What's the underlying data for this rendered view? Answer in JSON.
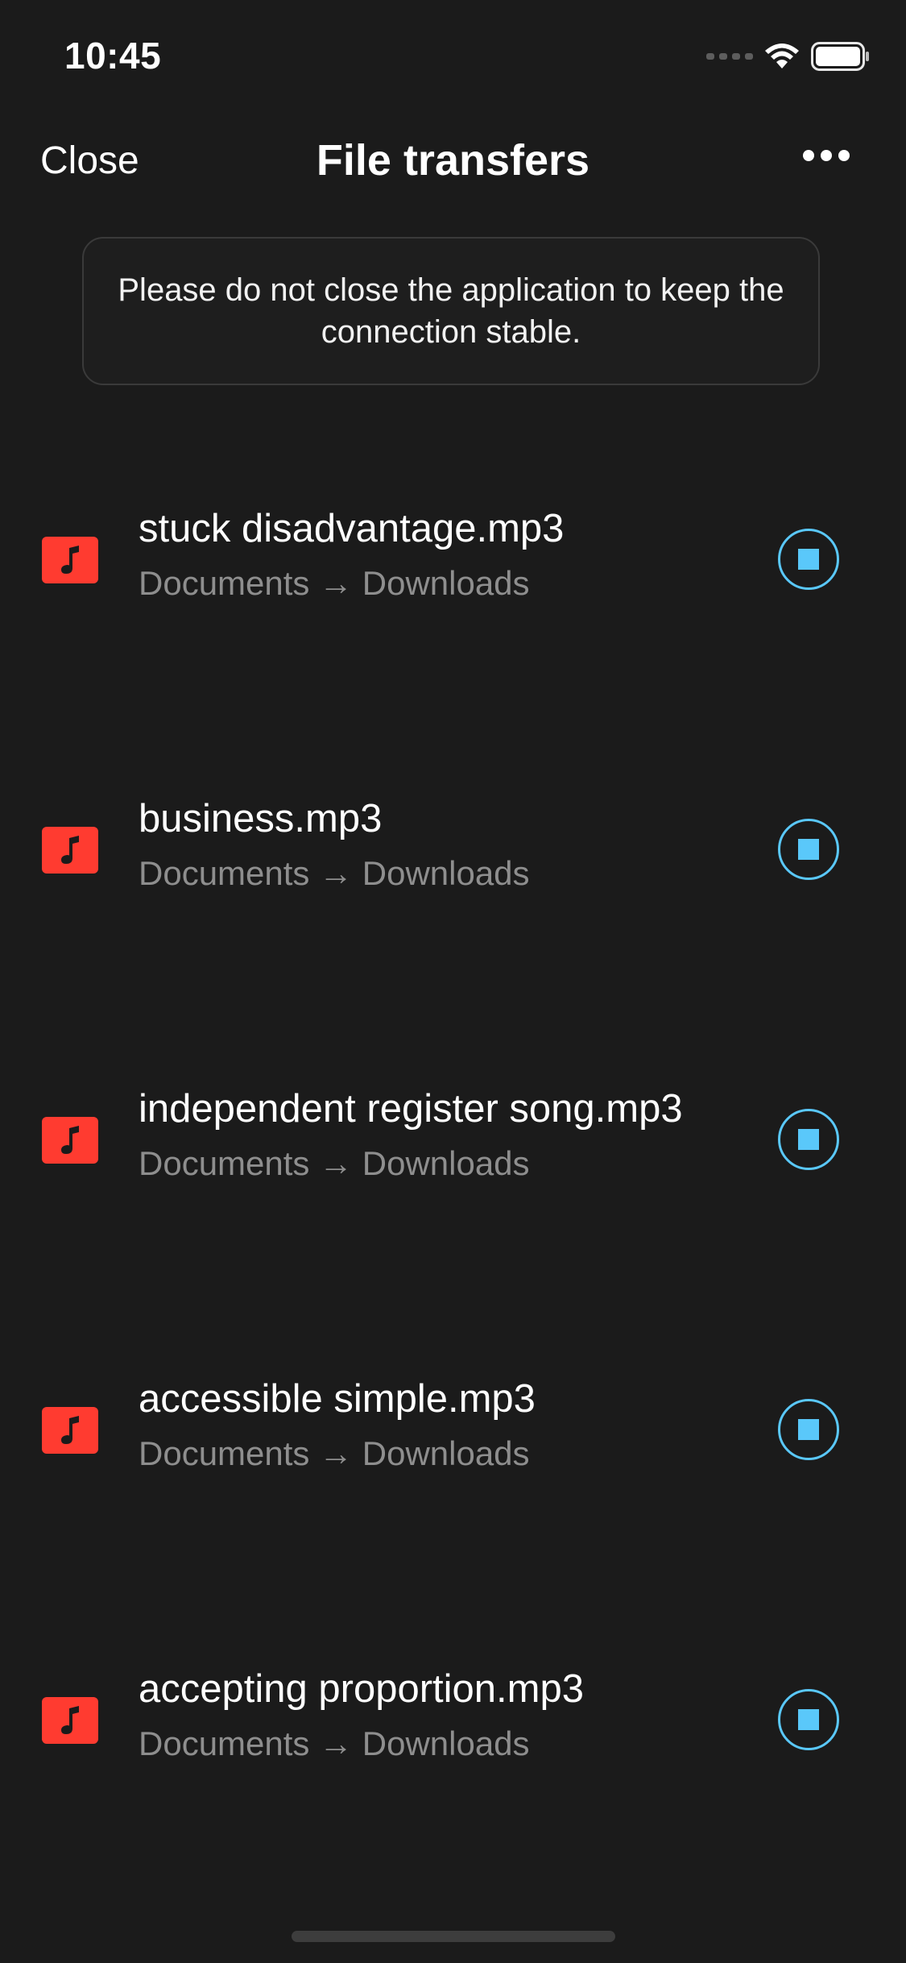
{
  "status_bar": {
    "time": "10:45"
  },
  "nav": {
    "close_label": "Close",
    "title": "File transfers",
    "more_icon": "ellipsis-icon"
  },
  "notice": {
    "text": "Please do not close the application to keep the connection stable."
  },
  "transfers": [
    {
      "name": "stuck disadvantage.mp3",
      "route": "Documents → Downloads",
      "icon": "music-note-icon"
    },
    {
      "name": "business.mp3",
      "route": "Documents → Downloads",
      "icon": "music-note-icon"
    },
    {
      "name": "independent register song.mp3",
      "route": "Documents → Downloads",
      "icon": "music-note-icon"
    },
    {
      "name": "accessible simple.mp3",
      "route": "Documents → Downloads",
      "icon": "music-note-icon"
    },
    {
      "name": "accepting proportion.mp3",
      "route": "Documents → Downloads",
      "icon": "music-note-icon"
    }
  ],
  "colors": {
    "background": "#1b1b1b",
    "file_icon": "#ff3b30",
    "accent": "#5ac8fa",
    "secondary_text": "#8e8e8e"
  }
}
